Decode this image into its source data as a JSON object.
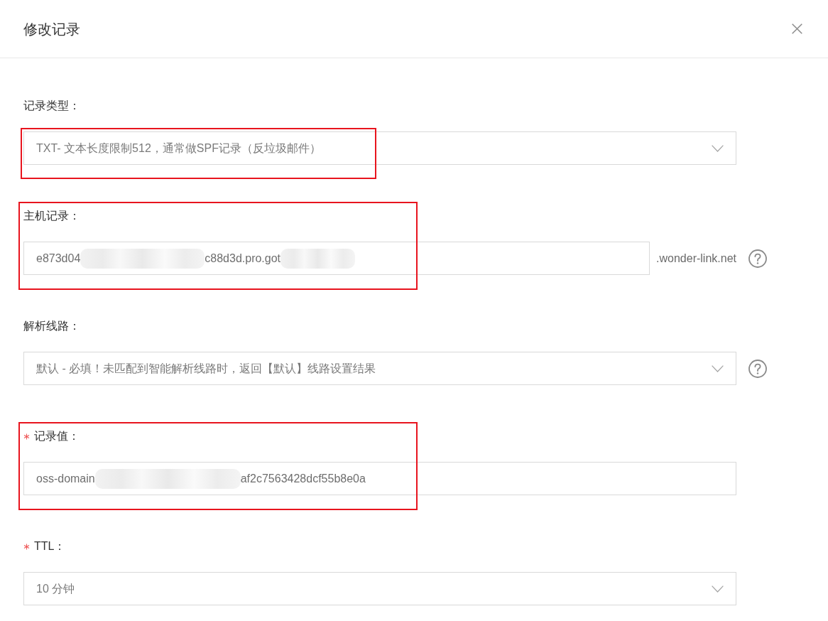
{
  "dialog": {
    "title": "修改记录"
  },
  "fields": [
    {
      "kind": "select",
      "label": "记录类型：",
      "required": false,
      "help": false,
      "highlighted": true,
      "value_parts": [
        {
          "kind": "text",
          "text": "TXT- 文本长度限制512，通常做SPF记录（反垃圾邮件）"
        }
      ]
    },
    {
      "kind": "input",
      "label": "主机记录：",
      "required": false,
      "help": true,
      "highlighted": true,
      "suffix": ".wonder-link.net",
      "value_parts": [
        {
          "kind": "text",
          "text": "e873d04"
        },
        {
          "kind": "redacted"
        },
        {
          "kind": "text",
          "text": "c88d3d.pro.got"
        },
        {
          "kind": "redacted"
        }
      ]
    },
    {
      "kind": "select",
      "label": "解析线路：",
      "required": false,
      "help": true,
      "highlighted": false,
      "value_parts": [
        {
          "kind": "text",
          "text": "默认 - 必填！未匹配到智能解析线路时，返回【默认】线路设置结果"
        }
      ]
    },
    {
      "kind": "input",
      "label": "记录值：",
      "required": true,
      "help": false,
      "highlighted": true,
      "value_parts": [
        {
          "kind": "text",
          "text": "oss-domain"
        },
        {
          "kind": "redacted"
        },
        {
          "kind": "text",
          "text": "af2c7563428dcf55b8e0a"
        }
      ]
    },
    {
      "kind": "select",
      "label": "TTL：",
      "required": true,
      "help": false,
      "highlighted": false,
      "value_parts": [
        {
          "kind": "text",
          "text": "10 分钟"
        }
      ]
    }
  ]
}
